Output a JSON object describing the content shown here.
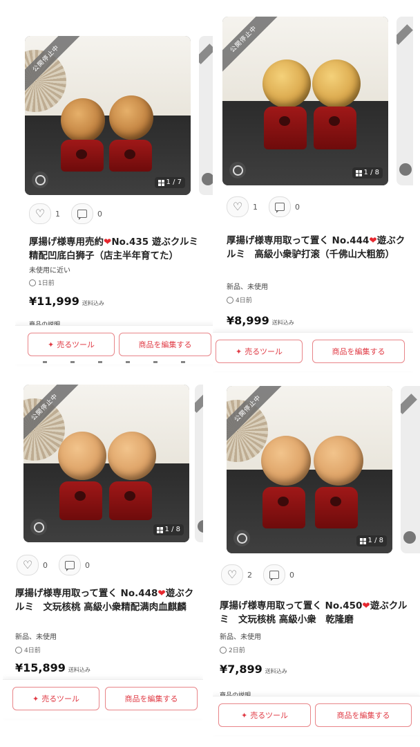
{
  "panels": [
    {
      "ribbon": "公開停止中",
      "photo_counter": "1 / 7",
      "likes": "1",
      "comments": "0",
      "title_part1": "厚揚げ様専用売約",
      "title_part2": "No.435 遊ぶクルミ　精配凹底白狮子（店主半年育てた）",
      "condition": "未使用に近い",
      "posted": "1日前",
      "price": "¥11,999",
      "shipping": "送料込み",
      "desc_label": "商品の説明"
    },
    {
      "ribbon": "公開停止中",
      "photo_counter": "1 / 8",
      "likes": "1",
      "comments": "0",
      "title_part1": "厚揚げ様専用取って置く No.444",
      "title_part2": "遊ぶクルミ　高級小衆驴打滚（千佛山大粗筋）",
      "condition": "新品、未使用",
      "posted": "4日前",
      "price": "¥8,999",
      "shipping": "送料込み",
      "desc_label": ""
    },
    {
      "ribbon": "公開停止中",
      "photo_counter": "1 / 8",
      "likes": "0",
      "comments": "0",
      "title_part1": "厚揚げ様専用取って置く No.448",
      "title_part2": "遊ぶクルミ　文玩核桃 高級小衆精配满肉血麒麟",
      "condition": "新品、未使用",
      "posted": "4日前",
      "price": "¥15,899",
      "shipping": "送料込み",
      "desc_label": ""
    },
    {
      "ribbon": "公開停止中",
      "photo_counter": "1 / 8",
      "likes": "2",
      "comments": "0",
      "title_part1": "厚揚げ様専用取って置く No.450",
      "title_part2": "遊ぶクルミ　文玩核桃 高級小衆　乾隆磨",
      "condition": "新品、未使用",
      "posted": "2日前",
      "price": "¥7,899",
      "shipping": "送料込み",
      "desc_label": "商品の説明"
    }
  ],
  "buttons": {
    "tool": "売るツール",
    "edit": "商品を編集する"
  },
  "colors": {
    "accent": "#e03b45",
    "heart": "#e6272e"
  }
}
